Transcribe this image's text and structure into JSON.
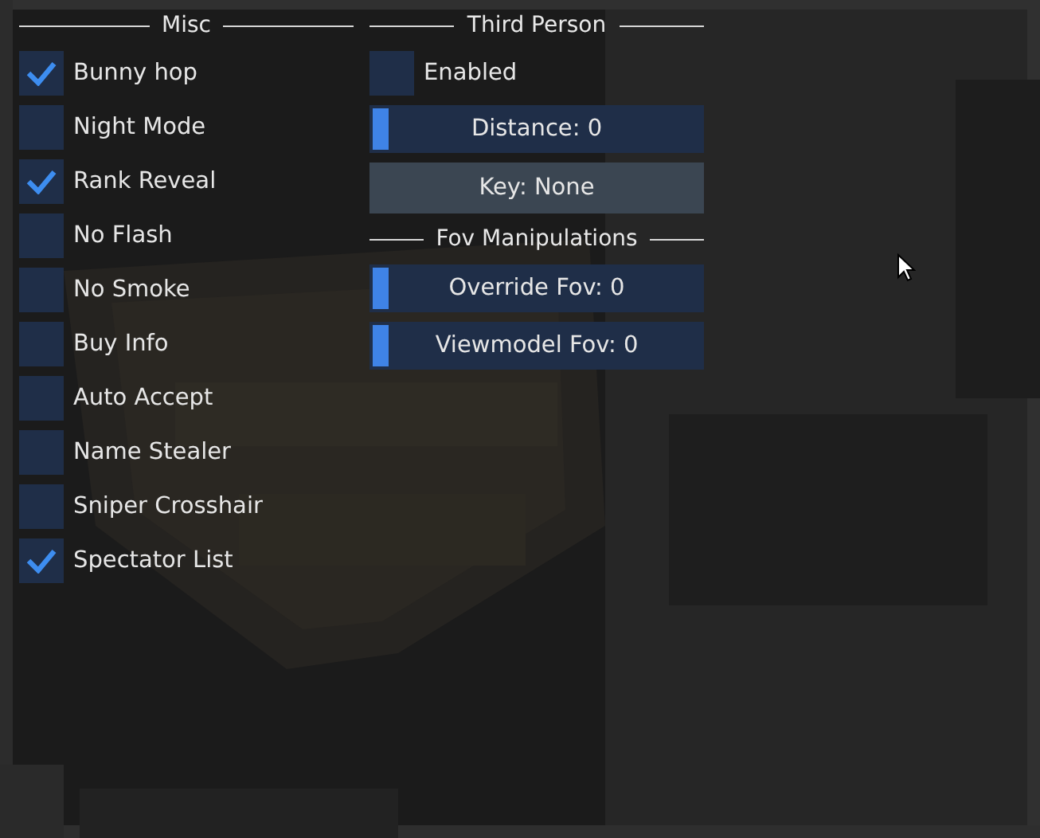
{
  "misc": {
    "title": "Misc",
    "options": [
      {
        "label": "Bunny hop",
        "checked": true
      },
      {
        "label": "Night Mode",
        "checked": false
      },
      {
        "label": "Rank Reveal",
        "checked": true
      },
      {
        "label": "No Flash",
        "checked": false
      },
      {
        "label": "No Smoke",
        "checked": false
      },
      {
        "label": "Buy Info",
        "checked": false
      },
      {
        "label": "Auto Accept",
        "checked": false
      },
      {
        "label": "Name Stealer",
        "checked": false
      },
      {
        "label": "Sniper Crosshair",
        "checked": false
      },
      {
        "label": "Spectator List",
        "checked": true
      }
    ]
  },
  "third_person": {
    "title": "Third Person",
    "enabled": {
      "label": "Enabled",
      "checked": false
    },
    "distance": {
      "label": "Distance: 0",
      "level": 0
    },
    "key_button": "Key: None"
  },
  "fov": {
    "title": "Fov Manipulations",
    "sliders": [
      {
        "label": "Override Fov: 0",
        "level": 0
      },
      {
        "label": "Viewmodel Fov: 0",
        "level": 0
      }
    ]
  }
}
